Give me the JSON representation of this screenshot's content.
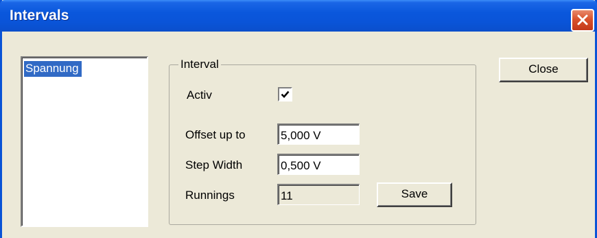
{
  "window": {
    "title": "Intervals"
  },
  "list": {
    "items": [
      {
        "label": "Spannung",
        "selected": true
      }
    ]
  },
  "interval": {
    "group_title": "Interval",
    "activ_label": "Activ",
    "activ_checked": true,
    "offset_label": "Offset up to",
    "offset_value": "5,000 V",
    "step_label": "Step Width",
    "step_value": "0,500 V",
    "runnings_label": "Runnings",
    "runnings_value": "11",
    "save_label": "Save"
  },
  "buttons": {
    "close_label": "Close"
  },
  "colors": {
    "titlebar": "#0A54D8",
    "selection": "#316AC5",
    "close_button": "#D9522C",
    "face": "#ECE9D8"
  }
}
